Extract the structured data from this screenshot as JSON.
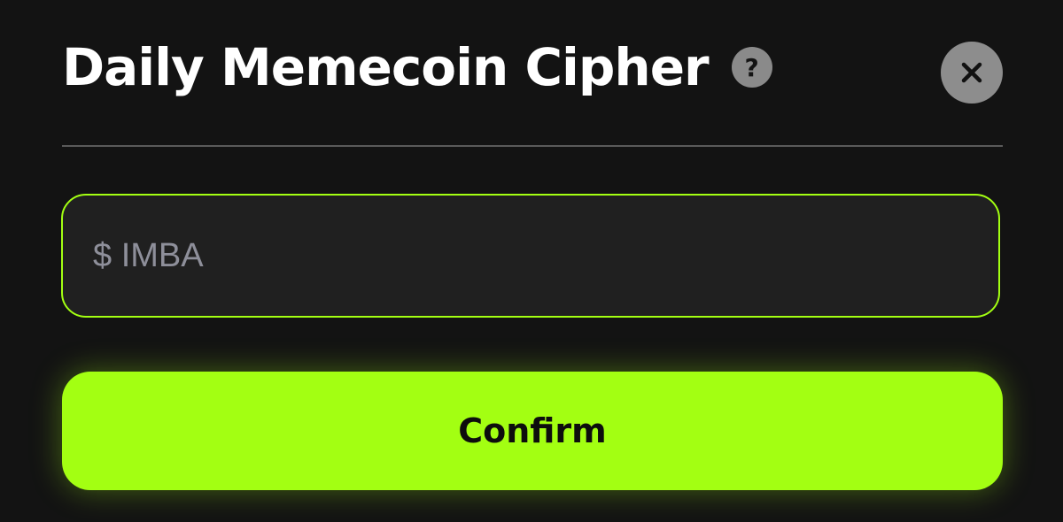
{
  "modal": {
    "title": "Daily Memecoin Cipher",
    "help_icon_glyph": "?",
    "close_icon": "close-icon",
    "help_icon": "question-icon"
  },
  "input": {
    "placeholder": "$ IMBA",
    "value": ""
  },
  "confirm": {
    "label": "Confirm"
  },
  "colors": {
    "background": "#131313",
    "accent": "#a3ff12",
    "input_bg": "#202020",
    "icon_bg": "#8a8a8a"
  }
}
